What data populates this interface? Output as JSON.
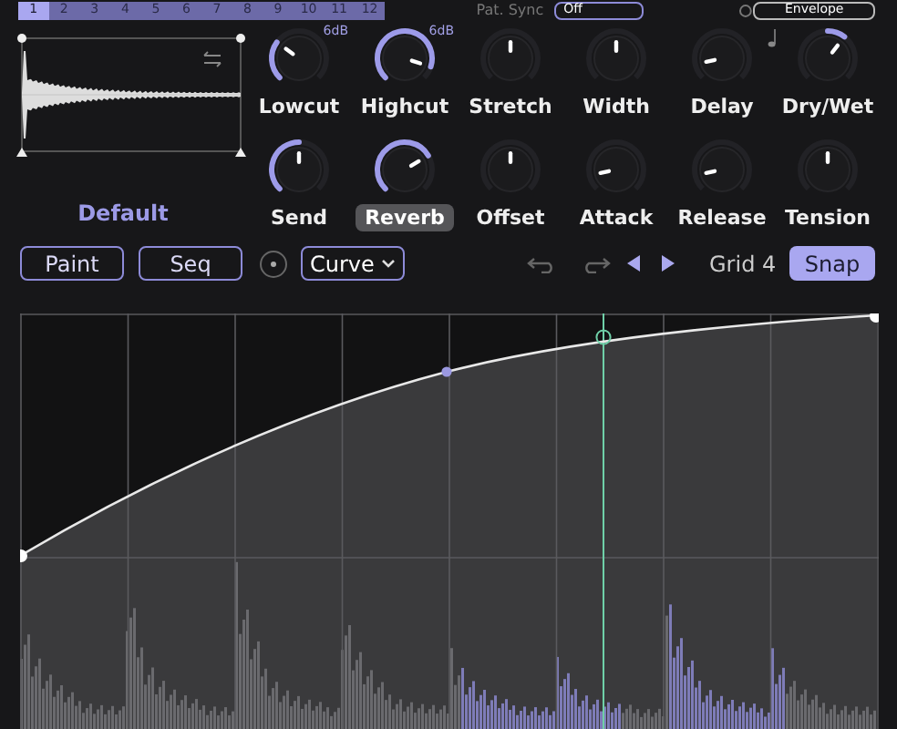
{
  "steps": [
    {
      "label": "1",
      "selected": true
    },
    {
      "label": "2",
      "selected": false
    },
    {
      "label": "3",
      "selected": false
    },
    {
      "label": "4",
      "selected": false
    },
    {
      "label": "5",
      "selected": false
    },
    {
      "label": "6",
      "selected": false
    },
    {
      "label": "7",
      "selected": false
    },
    {
      "label": "8",
      "selected": false
    },
    {
      "label": "9",
      "selected": false
    },
    {
      "label": "10",
      "selected": false
    },
    {
      "label": "11",
      "selected": false
    },
    {
      "label": "12",
      "selected": false
    }
  ],
  "pattern_sync": {
    "label": "Pat. Sync",
    "value": "Off"
  },
  "envelope_button": "Envelope",
  "sample": {
    "name": "Default"
  },
  "knobs": [
    {
      "label": "Lowcut",
      "level": 0.3,
      "kind": "fill",
      "badge": "6dB",
      "selected": false
    },
    {
      "label": "Highcut",
      "level": 0.9,
      "kind": "fill",
      "badge": "6dB",
      "selected": false
    },
    {
      "label": "Stretch",
      "level": 0.5,
      "kind": "plain",
      "selected": false
    },
    {
      "label": "Width",
      "level": 0.5,
      "kind": "plain",
      "selected": false
    },
    {
      "label": "Delay",
      "level": 0.12,
      "kind": "plain",
      "note": true,
      "selected": false
    },
    {
      "label": "Dry/Wet",
      "level": 0.64,
      "kind": "center",
      "selected": false
    },
    {
      "label": "Send",
      "level": 0.5,
      "kind": "fill",
      "selected": false
    },
    {
      "label": "Reverb",
      "level": 0.72,
      "kind": "fill",
      "selected": true
    },
    {
      "label": "Offset",
      "level": 0.5,
      "kind": "plain",
      "selected": false
    },
    {
      "label": "Attack",
      "level": 0.12,
      "kind": "plain",
      "selected": false
    },
    {
      "label": "Release",
      "level": 0.12,
      "kind": "plain",
      "selected": false
    },
    {
      "label": "Tension",
      "level": 0.5,
      "kind": "plain",
      "selected": false
    }
  ],
  "toolbar": {
    "modes": [
      {
        "label": "Paint",
        "selected": false
      },
      {
        "label": "Seq",
        "selected": false
      }
    ],
    "curve": "Curve",
    "grid": "Grid 4",
    "snap": {
      "label": "Snap",
      "selected": true
    }
  }
}
